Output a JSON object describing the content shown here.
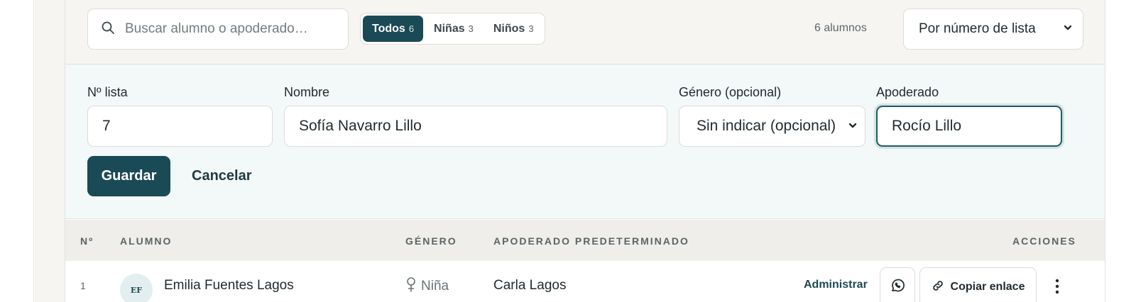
{
  "toolbar": {
    "search_placeholder": "Buscar alumno o apoderado…",
    "filters": [
      {
        "label": "Todos",
        "count": "6",
        "active": true
      },
      {
        "label": "Niñas",
        "count": "3",
        "active": false
      },
      {
        "label": "Niños",
        "count": "3",
        "active": false
      }
    ],
    "student_count": "6 alumnos",
    "sort_value": "Por número de lista"
  },
  "form": {
    "list_number_label": "Nº lista",
    "list_number_value": "7",
    "name_label": "Nombre",
    "name_value": "Sofía Navarro Lillo",
    "gender_label": "Género (opcional)",
    "gender_value": "Sin indicar (opcional)",
    "guardian_label": "Apoderado",
    "guardian_value": "Rocío Lillo",
    "save_label": "Guardar",
    "cancel_label": "Cancelar"
  },
  "table": {
    "headers": {
      "number": "Nº",
      "student": "ALUMNO",
      "gender": "GÉNERO",
      "guardian": "APODERADO PREDETERMINADO",
      "actions": "ACCIONES"
    },
    "rows": [
      {
        "number": "1",
        "initials": "EF",
        "name": "Emilia Fuentes Lagos",
        "gender": "Niña",
        "guardian": "Carla Lagos",
        "manage_label": "Administrar",
        "copy_label": "Copiar enlace"
      }
    ]
  },
  "colors": {
    "accent": "#1a4a55",
    "toolbar_bg": "#f6f5f2",
    "form_bg": "#f3f8f9",
    "header_bg": "#efeeea"
  },
  "icons": {
    "search": "search-icon",
    "select": "chevron-down-icon",
    "gender": "female-symbol-icon",
    "whatsapp": "whatsapp-icon",
    "copy": "link-icon",
    "more": "more-vertical-icon"
  }
}
